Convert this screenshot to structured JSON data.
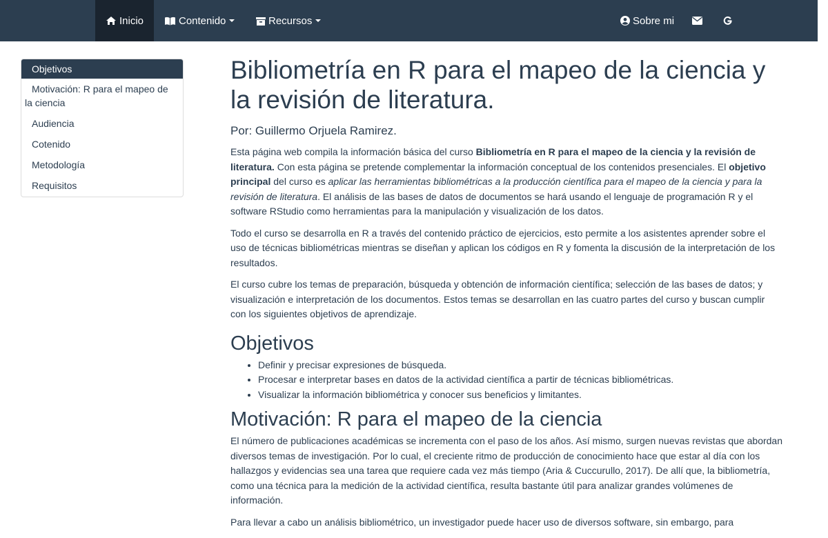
{
  "navbar": {
    "inicio": "Inicio",
    "contenido": "Contenido",
    "recursos": "Recursos",
    "sobre_mi": "Sobre mi"
  },
  "icons": {
    "home": "home-icon",
    "book": "book-icon",
    "archive": "archive-icon",
    "user": "user-circle-icon",
    "envelope": "envelope-icon",
    "google": "google-icon"
  },
  "colors": {
    "navbar_bg": "#2c3e50",
    "navbar_active": "#1a242f",
    "text": "#2c3e50"
  },
  "toc": {
    "items": [
      "Objetivos",
      "Motivación: R para el mapeo de la ciencia",
      "Audiencia",
      "Cotenido",
      "Metodología",
      "Requisitos"
    ]
  },
  "main": {
    "title": "Bibliometría en R para el mapeo de la ciencia y la revisión de literatura.",
    "author": "Por: Guillermo Orjuela Ramirez.",
    "p1": {
      "a": "Esta página web compila la información básica del curso ",
      "b": "Bibliometría en R para el mapeo de la ciencia y la revisión de literatura.",
      "c": " Con esta página se pretende complementar la información conceptual de los contenidos presenciales. El ",
      "d": "objetivo principal",
      "e": " del curso es ",
      "f": "aplicar las herramientas bibliométricas a la producción científica para el mapeo de la ciencia y para la revisión de literatura",
      "g": ". El análisis de las bases de datos de documentos se hará usando el lenguaje de programación R y el software RStudio como herramientas para la manipulación y visualización de los datos."
    },
    "p2": "Todo el curso se desarrolla en R a través del contenido práctico de ejercicios, esto permite a los asistentes aprender sobre el uso de técnicas bibliométricas mientras se diseñan y aplican los códigos en R y fomenta la discusión de la interpretación de los resultados.",
    "p3": "El curso cubre los temas de preparación, búsqueda y obtención de información científica; selección de las bases de datos; y visualización e interpretación de los documentos. Estos temas se desarrollan en las cuatro partes del curso y buscan cumplir con los siguientes objetivos de aprendizaje.",
    "h_objetivos": "Objetivos",
    "objetivos": [
      "Definir y precisar expresiones de búsqueda.",
      "Procesar e interpretar bases en datos de la actividad científica a partir de técnicas bibliométricas.",
      "Visualizar la información bibliométrica y conocer sus beneficios y limitantes."
    ],
    "h_motivacion": "Motivación: R para el mapeo de la ciencia",
    "p4": "El número de publicaciones académicas se incrementa con el paso de los años. Así mismo, surgen nuevas revistas que abordan diversos temas de investigación. Por lo cual, el creciente ritmo de producción de conocimiento hace que estar al día con los hallazgos y evidencias sea una tarea que requiere cada vez más tiempo (Aria & Cuccurullo, 2017). De allí que, la bibliometría, como una técnica para la medición de la actividad científica, resulta bastante útil para analizar grandes volúmenes de información.",
    "p5": "Para llevar a cabo un análisis bibliométrico, un investigador puede hacer uso de diversos software, sin embargo, para"
  }
}
